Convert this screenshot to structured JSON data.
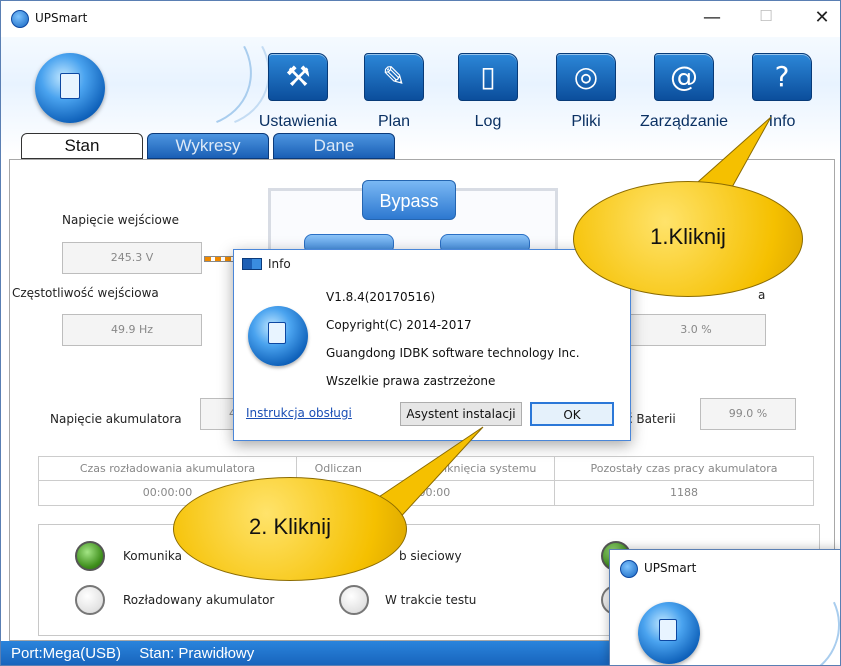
{
  "window": {
    "title": "UPSmart",
    "minimize": "—",
    "maximize": "☐",
    "close": "✕"
  },
  "toolbar": [
    {
      "name": "settings",
      "label": "Ustawienia",
      "icon": "hammer-icon",
      "glyph": "⚒"
    },
    {
      "name": "plan",
      "label": "Plan",
      "icon": "pencil-icon",
      "glyph": "✎"
    },
    {
      "name": "log",
      "label": "Log",
      "icon": "document-icon",
      "glyph": "▯"
    },
    {
      "name": "files",
      "label": "Pliki",
      "icon": "disc-icon",
      "glyph": "◎"
    },
    {
      "name": "management",
      "label": "Zarządzanie",
      "icon": "at-icon",
      "glyph": "@"
    },
    {
      "name": "info",
      "label": "Info",
      "icon": "question-icon",
      "glyph": "?"
    }
  ],
  "tabs": [
    {
      "label": "Stan",
      "active": true
    },
    {
      "label": "Wykresy",
      "active": false
    },
    {
      "label": "Dane",
      "active": false
    }
  ],
  "state": {
    "input_voltage_label": "Napięcie wejściowe",
    "input_voltage_value": "245.3 V",
    "input_freq_label": "Częstotliwość wejściowa",
    "input_freq_value": "49.9 Hz",
    "bypass_label": "Bypass",
    "load_label_partial": "a",
    "load_value": "3.0 %",
    "battery_voltage_label": "Napięcie akumulatora",
    "battery_voltage_value_partial": "4",
    "battery_capacity_label_partial": "ć Baterii",
    "battery_capacity_value": "99.0 %"
  },
  "times_table": {
    "headers": [
      "Czas rozładowania akumulatora",
      "Odliczanie do zamknięcia systemu",
      "Pozostały czas pracy akumulatora"
    ],
    "header_visible": [
      "Czas rozładowania akumulatora",
      "Odliczan",
      "zamknięcia systemu",
      "Pozostały czas pracy akumulatora"
    ],
    "values": [
      "00:00:00",
      "00:00:00",
      "1188"
    ]
  },
  "indicators": [
    {
      "label": "Komunika",
      "on": true
    },
    {
      "label": "b sieciowy",
      "on": false
    },
    {
      "label": "Rozładowany akumulator",
      "on": false
    },
    {
      "label": "W trakcie testu",
      "on": false
    }
  ],
  "statusbar": {
    "port": "Port:Mega(USB)",
    "state": "Stan: Prawidłowy"
  },
  "dialog": {
    "title": "Info",
    "version": "V1.8.4(20170516)",
    "copyright": "Copyright(C) 2014-2017",
    "company": "Guangdong IDBK software technology Inc.",
    "rights": "Wszelkie prawa zastrzeżone",
    "manual_link": "Instrukcja obsługi",
    "setup_button": "Asystent instalacji",
    "ok_button": "OK"
  },
  "callouts": {
    "first": "1.Kliknij",
    "second": "2. Kliknij"
  },
  "mini_window": {
    "title": "UPSmart"
  },
  "colors": {
    "accent": "#1a6fc8",
    "callout": "#f5c000",
    "status_bar": "#1f6fc8"
  }
}
